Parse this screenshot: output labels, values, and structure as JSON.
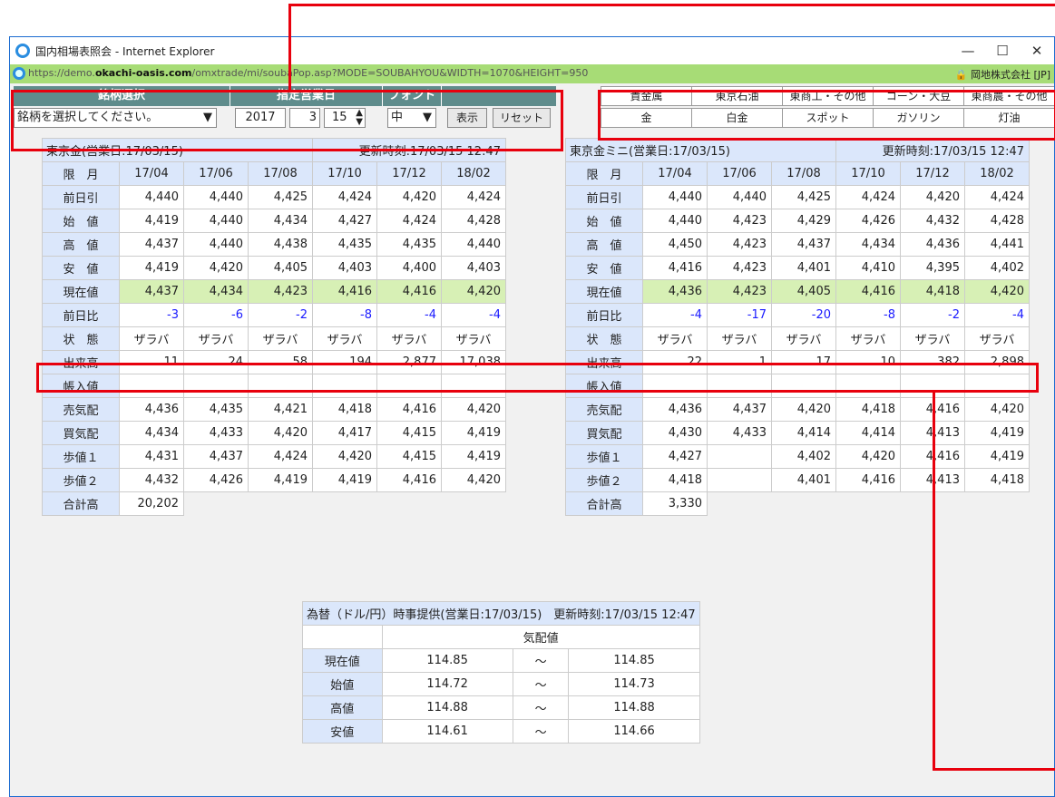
{
  "window": {
    "title": "国内相場表照会 - Internet Explorer",
    "url_pre": "https://demo.",
    "url_host": "okachi-oasis.com",
    "url_post": "/omxtrade/mi/soubaPop.asp?MODE=SOUBAHYOU&WIDTH=1070&HEIGHT=950",
    "cert": "岡地株式会社 [JP]",
    "min": "—",
    "max": "☐",
    "close": "✕"
  },
  "controls": {
    "h_meigara": "銘柄選択",
    "h_date": "指定営業日",
    "h_font": "フォント",
    "select_placeholder": "銘柄を選択してください。",
    "year": "2017",
    "month": "3",
    "day": "15",
    "font": "中",
    "show": "表示",
    "reset": "リセット"
  },
  "nav": {
    "row1": [
      "貴金属",
      "東京石油",
      "東商工・その他",
      "コーン・大豆",
      "東商農・その他"
    ],
    "row2": [
      "金",
      "白金",
      "スポット",
      "ガソリン",
      "灯油"
    ]
  },
  "labels": [
    "前日引",
    "始　値",
    "高　値",
    "安　値",
    "現在値",
    "前日比",
    "状　態",
    "出来高",
    "帳入値",
    "売気配",
    "買気配",
    "歩値１",
    "歩値２"
  ],
  "total_label": "合計高",
  "gold": {
    "caption": "東京金(営業日:17/03/15)",
    "updated": "更新時刻:17/03/15 12:47",
    "head": "限　月",
    "months": [
      "17/04",
      "17/06",
      "17/08",
      "17/10",
      "17/12",
      "18/02"
    ],
    "rows": [
      [
        "4,440",
        "4,440",
        "4,425",
        "4,424",
        "4,420",
        "4,424"
      ],
      [
        "4,419",
        "4,440",
        "4,434",
        "4,427",
        "4,424",
        "4,428"
      ],
      [
        "4,437",
        "4,440",
        "4,438",
        "4,435",
        "4,435",
        "4,440"
      ],
      [
        "4,419",
        "4,420",
        "4,405",
        "4,403",
        "4,400",
        "4,403"
      ],
      [
        "4,437",
        "4,434",
        "4,423",
        "4,416",
        "4,416",
        "4,420"
      ],
      [
        "-3",
        "-6",
        "-2",
        "-8",
        "-4",
        "-4"
      ],
      [
        "ザラバ",
        "ザラバ",
        "ザラバ",
        "ザラバ",
        "ザラバ",
        "ザラバ"
      ],
      [
        "11",
        "24",
        "58",
        "194",
        "2,877",
        "17,038"
      ],
      [
        "",
        "",
        "",
        "",
        "",
        ""
      ],
      [
        "4,436",
        "4,435",
        "4,421",
        "4,418",
        "4,416",
        "4,420"
      ],
      [
        "4,434",
        "4,433",
        "4,420",
        "4,417",
        "4,415",
        "4,419"
      ],
      [
        "4,431",
        "4,437",
        "4,424",
        "4,420",
        "4,415",
        "4,419"
      ],
      [
        "4,432",
        "4,426",
        "4,419",
        "4,419",
        "4,416",
        "4,420"
      ]
    ],
    "total": "20,202"
  },
  "mini": {
    "caption": "東京金ミニ(営業日:17/03/15)",
    "updated": "更新時刻:17/03/15 12:47",
    "head": "限　月",
    "months": [
      "17/04",
      "17/06",
      "17/08",
      "17/10",
      "17/12",
      "18/02"
    ],
    "rows": [
      [
        "4,440",
        "4,440",
        "4,425",
        "4,424",
        "4,420",
        "4,424"
      ],
      [
        "4,440",
        "4,423",
        "4,429",
        "4,426",
        "4,432",
        "4,428"
      ],
      [
        "4,450",
        "4,423",
        "4,437",
        "4,434",
        "4,436",
        "4,441"
      ],
      [
        "4,416",
        "4,423",
        "4,401",
        "4,410",
        "4,395",
        "4,402"
      ],
      [
        "4,436",
        "4,423",
        "4,405",
        "4,416",
        "4,418",
        "4,420"
      ],
      [
        "-4",
        "-17",
        "-20",
        "-8",
        "-2",
        "-4"
      ],
      [
        "ザラバ",
        "ザラバ",
        "ザラバ",
        "ザラバ",
        "ザラバ",
        "ザラバ"
      ],
      [
        "22",
        "1",
        "17",
        "10",
        "382",
        "2,898"
      ],
      [
        "",
        "",
        "",
        "",
        "",
        ""
      ],
      [
        "4,436",
        "4,437",
        "4,420",
        "4,418",
        "4,416",
        "4,420"
      ],
      [
        "4,430",
        "4,433",
        "4,414",
        "4,414",
        "4,413",
        "4,419"
      ],
      [
        "4,427",
        "",
        "4,402",
        "4,420",
        "4,416",
        "4,419"
      ],
      [
        "4,418",
        "",
        "4,401",
        "4,416",
        "4,413",
        "4,418"
      ]
    ],
    "total": "3,330"
  },
  "fx": {
    "caption": "為替（ドル/円）時事提供(営業日:17/03/15)　更新時刻:17/03/15 12:47",
    "head": "気配値",
    "tilde": "～",
    "rows": [
      {
        "label": "現在値",
        "low": "114.85",
        "high": "114.85"
      },
      {
        "label": "始値",
        "low": "114.72",
        "high": "114.73"
      },
      {
        "label": "高値",
        "low": "114.88",
        "high": "114.88"
      },
      {
        "label": "安値",
        "low": "114.61",
        "high": "114.66"
      }
    ]
  }
}
